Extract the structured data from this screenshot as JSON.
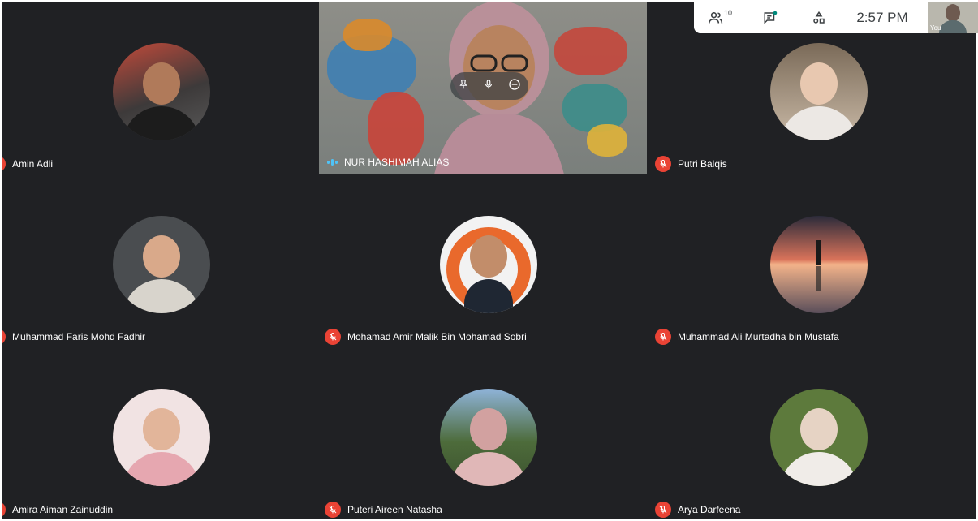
{
  "participants": [
    {
      "name": "Amin Adli"
    },
    {
      "name": "NUR HASHIMAH ALIAS"
    },
    {
      "name": "Putri Balqis"
    },
    {
      "name": "Muhammad Faris Mohd Fadhir"
    },
    {
      "name": "Mohamad Amir Malik Bin Mohamad Sobri"
    },
    {
      "name": "Muhammad Ali Murtadha bin Mustafa"
    },
    {
      "name": "Amira Aiman Zainuddin"
    },
    {
      "name": "Puteri Aireen Natasha"
    },
    {
      "name": "Arya Darfeena"
    }
  ],
  "topbar": {
    "people_count": "10",
    "time": "2:57 PM",
    "self_label": "You"
  },
  "icons": {
    "people": "people-icon",
    "chat": "chat-icon",
    "activities": "activities-icon",
    "mic_off": "mic-off-icon",
    "pin": "pin-icon",
    "mic": "mic-icon",
    "remove": "remove-icon"
  },
  "colors": {
    "background": "#202124",
    "mic_off": "#ea4335",
    "speaking_indicator": "#4fc3f7",
    "chat_dot": "#00897b"
  }
}
